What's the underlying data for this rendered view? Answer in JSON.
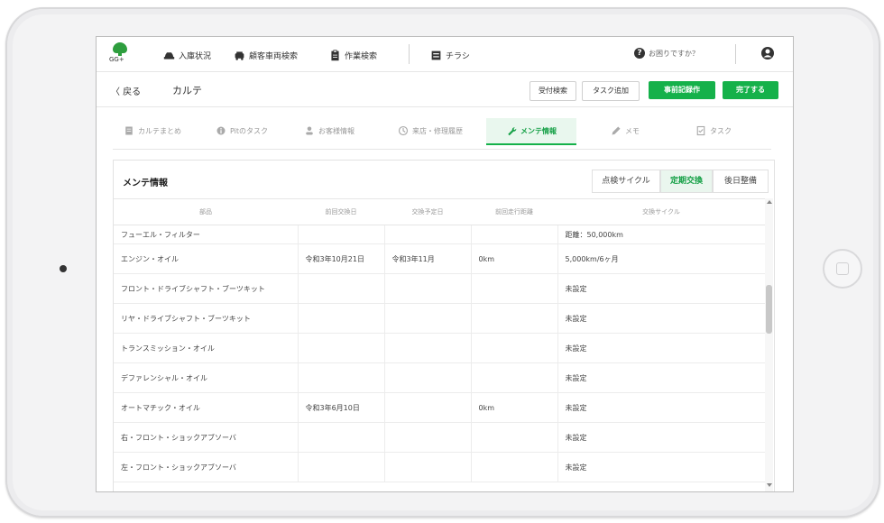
{
  "brand": {
    "text": "GG+"
  },
  "nav": [
    {
      "label": "入庫状況",
      "icon": "car-icon"
    },
    {
      "label": "顧客車両検索",
      "icon": "car-front-icon"
    },
    {
      "label": "作業検索",
      "icon": "clipboard-icon"
    },
    {
      "label": "チラシ",
      "icon": "flyer-icon"
    }
  ],
  "help": {
    "label": "お困りですか？"
  },
  "subheader": {
    "back_label": "〈 戻る",
    "title": "カルテ",
    "buttons": [
      {
        "label": "受付検索",
        "style": "outline"
      },
      {
        "label": "タスク追加",
        "style": "outline"
      },
      {
        "label": "事前記録作",
        "style": "green"
      },
      {
        "label": "完了する",
        "style": "green"
      }
    ]
  },
  "tabs": [
    {
      "label": "カルテまとめ",
      "icon": "document-icon"
    },
    {
      "label": "Pitのタスク",
      "icon": "info-icon"
    },
    {
      "label": "お客様情報",
      "icon": "person-icon"
    },
    {
      "label": "来店・修理履歴",
      "icon": "history-icon"
    },
    {
      "label": "メンテ情報",
      "icon": "wrench-icon",
      "active": true
    },
    {
      "label": "メモ",
      "icon": "pencil-icon"
    },
    {
      "label": "タスク",
      "icon": "task-icon"
    }
  ],
  "panel": {
    "title": "メンテ情報",
    "segments": [
      {
        "label": "点検サイクル",
        "selected": false
      },
      {
        "label": "定期交換",
        "selected": true
      },
      {
        "label": "後日整備",
        "selected": false
      }
    ]
  },
  "table": {
    "headers": [
      "部品",
      "前回交換日",
      "交換予定日",
      "前回走行距離",
      "交換サイクル"
    ],
    "rows": [
      [
        "フューエル・フィルター",
        "",
        "",
        "",
        "距離：50,000km"
      ],
      [
        "エンジン・オイル",
        "令和3年10月21日",
        "令和3年11月",
        "0km",
        "5,000km/6ヶ月"
      ],
      [
        "フロント・ドライブシャフト・ブーツキット",
        "",
        "",
        "",
        "未設定"
      ],
      [
        "リヤ・ドライブシャフト・ブーツキット",
        "",
        "",
        "",
        "未設定"
      ],
      [
        "トランスミッション・オイル",
        "",
        "",
        "",
        "未設定"
      ],
      [
        "デファレンシャル・オイル",
        "",
        "",
        "",
        "未設定"
      ],
      [
        "オートマチック・オイル",
        "令和3年6月10日",
        "",
        "0km",
        "未設定"
      ],
      [
        "右・フロント・ショックアブソーバ",
        "",
        "",
        "",
        "未設定"
      ],
      [
        "左・フロント・ショックアブソーバ",
        "",
        "",
        "",
        "未設定"
      ]
    ]
  },
  "colors": {
    "accent": "#15b14a",
    "accent_light": "#e9f7ee"
  }
}
